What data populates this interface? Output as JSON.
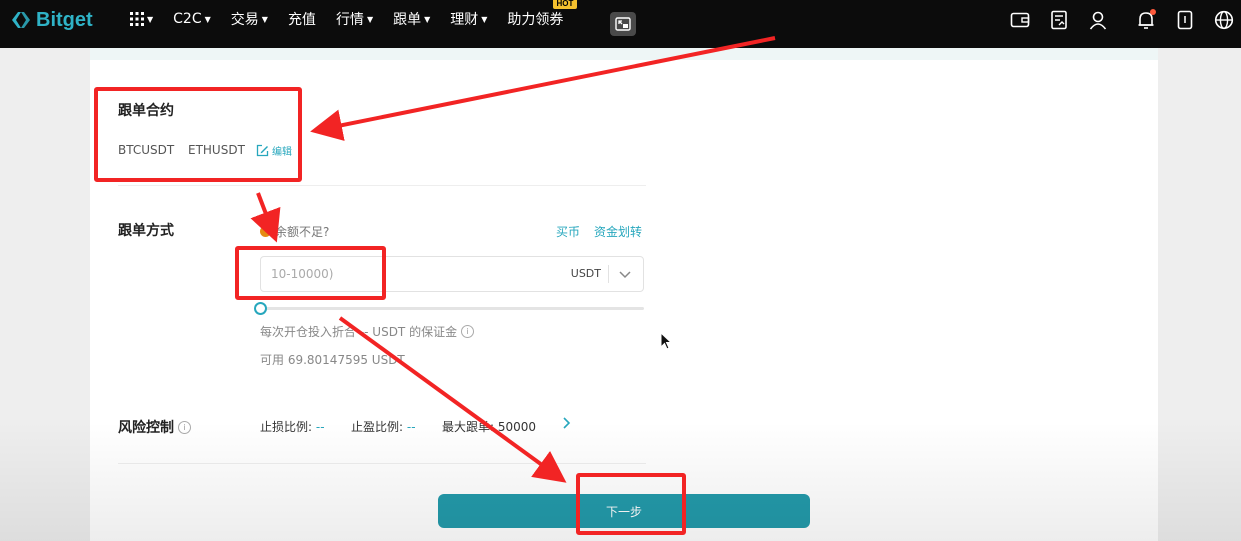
{
  "topbar": {
    "logo_text": "Bitget",
    "nav": [
      {
        "label": "C2C",
        "has_caret": true
      },
      {
        "label": "交易",
        "has_caret": true
      },
      {
        "label": "充值",
        "has_caret": false
      },
      {
        "label": "行情",
        "has_caret": true
      },
      {
        "label": "跟单",
        "has_caret": true
      },
      {
        "label": "理财",
        "has_caret": true
      },
      {
        "label": "助力领券",
        "has_caret": false
      }
    ],
    "hot_badge": "HOT",
    "icons": [
      "wallet-icon",
      "orders-icon",
      "user-icon",
      "bell-icon",
      "download-icon",
      "globe-icon"
    ]
  },
  "copy_contracts": {
    "title": "跟单合约",
    "pairs": [
      "BTCUSDT",
      "ETHUSDT"
    ],
    "edit_label": "编辑"
  },
  "copy_mode": {
    "title": "跟单方式",
    "balance_warning": "余额不足?",
    "buy_link": "买币",
    "transfer_link": "资金划转",
    "amount_placeholder": "10-10000)",
    "unit": "USDT",
    "margin_hint": "每次开仓投入折合 -- USDT 的保证金",
    "available": "可用 69.80147595 USDT"
  },
  "risk_control": {
    "title": "风险控制",
    "stop_loss_label": "止损比例:",
    "stop_loss_value": "--",
    "take_profit_label": "止盈比例:",
    "take_profit_value": "--",
    "max_copy_label": "最大跟单:",
    "max_copy_value": "50000"
  },
  "next_button": "下一步",
  "colors": {
    "accent": "#27a7bd",
    "button": "#239aaa",
    "annotation": "#f22424",
    "warning": "#e58a12"
  }
}
